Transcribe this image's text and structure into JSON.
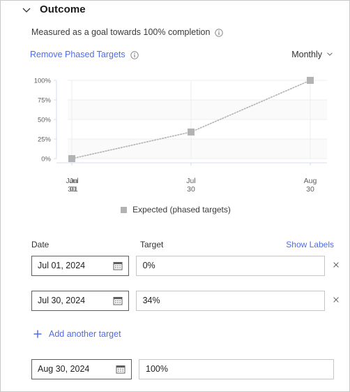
{
  "section": {
    "title": "Outcome",
    "collapse_icon": "chevron-down-icon",
    "subtitle": "Measured as a goal towards 100% completion",
    "subtitle_info_icon": "info-icon",
    "remove_link": "Remove Phased Targets",
    "remove_link_info_icon": "info-icon",
    "period_value": "Monthly",
    "period_icon": "chevron-down-icon"
  },
  "chart_data": {
    "type": "line",
    "title": "",
    "xlabel": "",
    "ylabel": "",
    "ylim": [
      0,
      100
    ],
    "ytick_labels": [
      "0%",
      "25%",
      "50%",
      "75%",
      "100%"
    ],
    "ytick_values": [
      0,
      25,
      50,
      75,
      100
    ],
    "grid": true,
    "legend_position": "bottom",
    "x_tick_labels": [
      {
        "line1": "Jun",
        "line2": "30",
        "overlap_line1": "Jul",
        "overlap_line2": "01"
      },
      {
        "line1": "Jul",
        "line2": "30"
      },
      {
        "line1": "Aug",
        "line2": "30"
      }
    ],
    "series": [
      {
        "name": "Expected (phased targets)",
        "color": "#b3b3b3",
        "line_style": "dotted",
        "marker": "square",
        "x": [
          "Jul 01",
          "Jul 30",
          "Aug 30"
        ],
        "values": [
          0,
          34,
          100
        ]
      }
    ]
  },
  "table": {
    "headers": {
      "date": "Date",
      "target": "Target"
    },
    "show_labels_link": "Show Labels",
    "calendar_icon": "calendar-icon",
    "delete_icon": "close-icon",
    "rows": [
      {
        "date": "Jul 01, 2024",
        "target": "0%",
        "deletable": true
      },
      {
        "date": "Jul 30, 2024",
        "target": "34%",
        "deletable": true
      },
      {
        "date": "Aug 30, 2024",
        "target": "100%",
        "deletable": false
      }
    ],
    "add_label": "Add another target",
    "add_icon": "plus-icon"
  },
  "colors": {
    "link": "#4f6bed",
    "series": "#b3b3b3",
    "text": "#201f1e",
    "muted": "#605e5c"
  }
}
